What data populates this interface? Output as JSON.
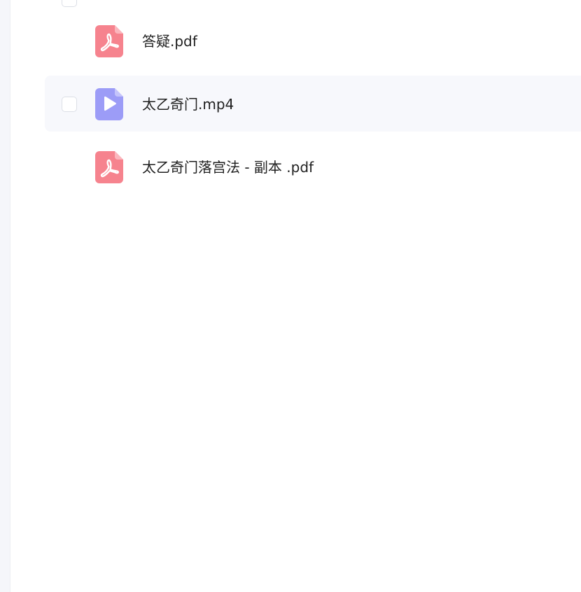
{
  "files": [
    {
      "name": "答疑.pdf",
      "type": "pdf",
      "icon": "pdf-icon"
    },
    {
      "name": "太乙奇门.mp4",
      "type": "video",
      "icon": "video-file-icon"
    },
    {
      "name": "太乙奇门落宫法 - 副本 .pdf",
      "type": "pdf",
      "icon": "pdf-icon"
    }
  ],
  "colors": {
    "pdf": "#f6838e",
    "video": "#9c9cf7",
    "row_hover": "#f7f8fc"
  }
}
